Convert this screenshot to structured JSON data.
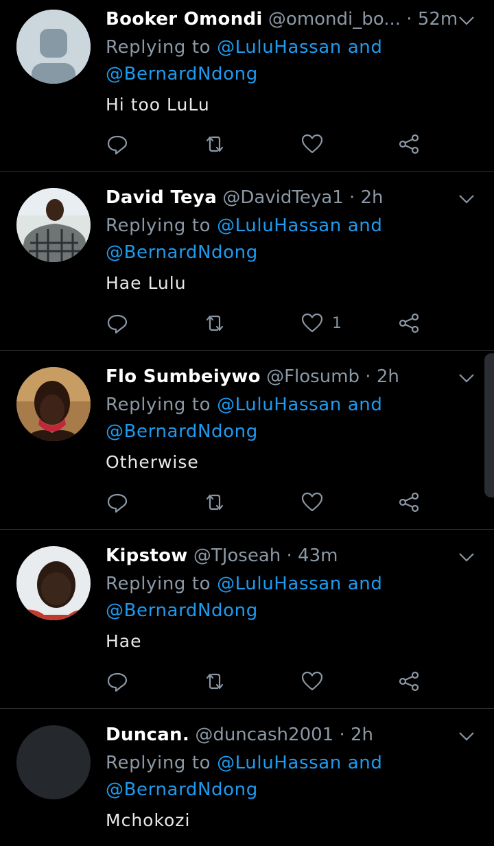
{
  "replying_prefix": "Replying to",
  "mention_1": "@LuluHassan and",
  "mention_2": "@BernardNdong",
  "colors": {
    "accent": "#1d9bf0",
    "muted": "#8b98a5",
    "background": "#000000",
    "divider": "#2f3336"
  },
  "tweets": [
    {
      "name": "Booker Omondi",
      "handle": "@omondi_bo...",
      "sep": "·",
      "time": "52m",
      "text": "Hi too LuLu",
      "likes": ""
    },
    {
      "name": "David Teya",
      "handle": "@DavidTeya1",
      "sep": "·",
      "time": "2h",
      "text": "Hae Lulu",
      "likes": "1"
    },
    {
      "name": "Flo Sumbeiywo",
      "handle": "@Flosumb",
      "sep": "·",
      "time": "2h",
      "text": "Otherwise",
      "likes": ""
    },
    {
      "name": "Kipstow",
      "handle": "@TJoseah",
      "sep": "·",
      "time": "43m",
      "text": "Hae",
      "likes": ""
    },
    {
      "name": "Duncan.",
      "handle": "@duncash2001",
      "sep": "·",
      "time": "2h",
      "text": "Mchokozi",
      "likes": ""
    }
  ],
  "icons": [
    "chevron-down-icon",
    "reply-icon",
    "retweet-icon",
    "like-icon",
    "share-icon"
  ]
}
